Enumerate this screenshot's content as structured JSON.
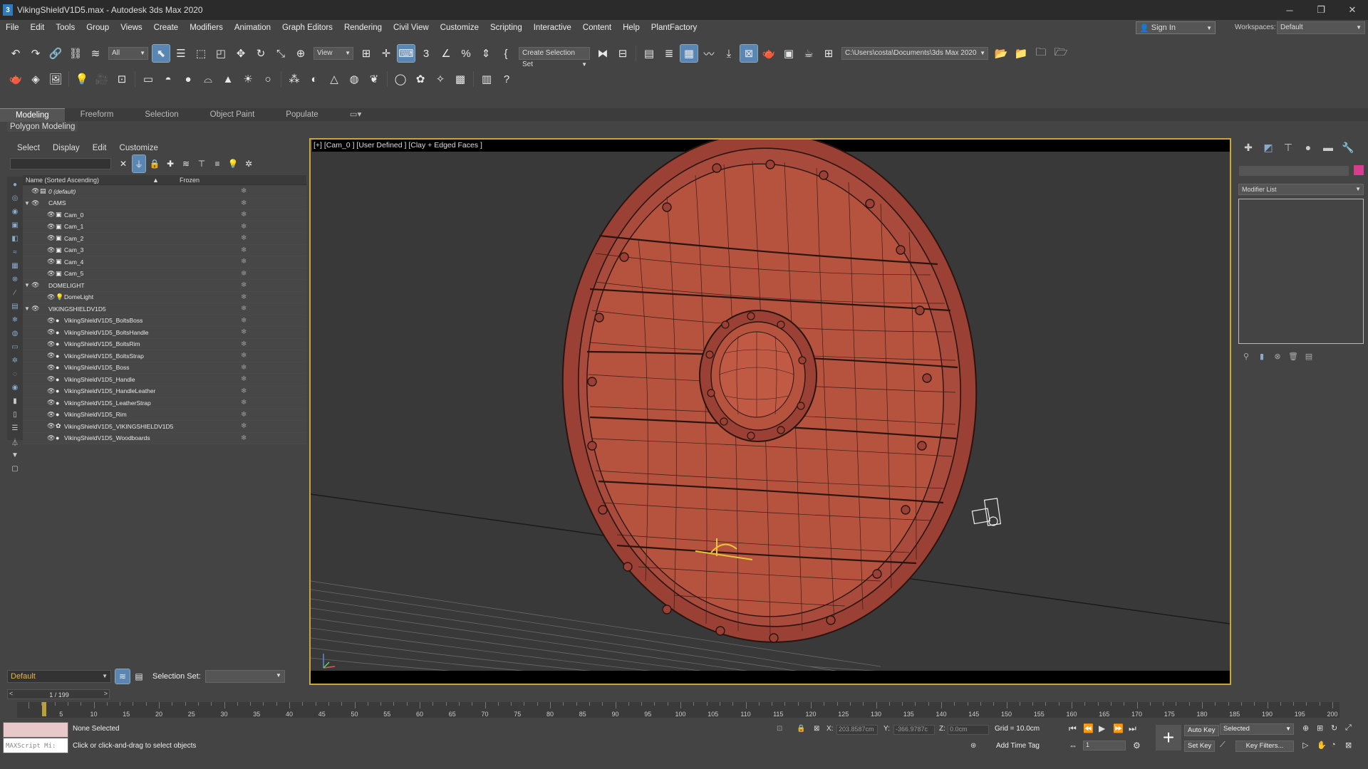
{
  "window": {
    "title": "VikingShieldV1D5.max - Autodesk 3ds Max 2020",
    "app_icon": "3",
    "controls": [
      "─",
      "❐",
      "✕"
    ]
  },
  "menu": [
    "File",
    "Edit",
    "Tools",
    "Group",
    "Views",
    "Create",
    "Modifiers",
    "Animation",
    "Graph Editors",
    "Rendering",
    "Civil View",
    "Customize",
    "Scripting",
    "Interactive",
    "Content",
    "Help",
    "PlantFactory"
  ],
  "signin": {
    "label": "Sign In"
  },
  "workspaces": {
    "label": "Workspaces:",
    "value": "Default"
  },
  "toolbar": {
    "filter": "All",
    "ref_coord": "View",
    "selection_set": "Create Selection Set",
    "project_path": "C:\\Users\\costa\\Documents\\3ds Max 2020"
  },
  "ribbon": {
    "tabs": [
      "Modeling",
      "Freeform",
      "Selection",
      "Object Paint",
      "Populate"
    ],
    "panel": "Polygon Modeling"
  },
  "explorer": {
    "menu": [
      "Select",
      "Display",
      "Edit",
      "Customize"
    ],
    "columns": {
      "name": "Name (Sorted Ascending)",
      "sort": "▲",
      "frozen": "Frozen"
    },
    "rows": [
      {
        "label": "0 (default)",
        "level": 0,
        "exp": "",
        "icon": "layer"
      },
      {
        "label": "CAMS",
        "level": 0,
        "exp": "▼",
        "icon": "none"
      },
      {
        "label": "Cam_0",
        "level": 1,
        "exp": "",
        "icon": "camera"
      },
      {
        "label": "Cam_1",
        "level": 1,
        "exp": "",
        "icon": "camera"
      },
      {
        "label": "Cam_2",
        "level": 1,
        "exp": "",
        "icon": "camera"
      },
      {
        "label": "Cam_3",
        "level": 1,
        "exp": "",
        "icon": "camera"
      },
      {
        "label": "Cam_4",
        "level": 1,
        "exp": "",
        "icon": "camera"
      },
      {
        "label": "Cam_5",
        "level": 1,
        "exp": "",
        "icon": "camera"
      },
      {
        "label": "DOMELIGHT",
        "level": 0,
        "exp": "▼",
        "icon": "none"
      },
      {
        "label": "DomeLight",
        "level": 1,
        "exp": "",
        "icon": "light"
      },
      {
        "label": "VIKINGSHIELDV1D5",
        "level": 0,
        "exp": "▼",
        "icon": "none"
      },
      {
        "label": "VikingShieldV1D5_BoltsBoss",
        "level": 1,
        "exp": "",
        "icon": "geo"
      },
      {
        "label": "VikingShieldV1D5_BoltsHandle",
        "level": 1,
        "exp": "",
        "icon": "geo"
      },
      {
        "label": "VikingShieldV1D5_BoltsRim",
        "level": 1,
        "exp": "",
        "icon": "geo"
      },
      {
        "label": "VikingShieldV1D5_BoltsStrap",
        "level": 1,
        "exp": "",
        "icon": "geo"
      },
      {
        "label": "VikingShieldV1D5_Boss",
        "level": 1,
        "exp": "",
        "icon": "geo"
      },
      {
        "label": "VikingShieldV1D5_Handle",
        "level": 1,
        "exp": "",
        "icon": "geo"
      },
      {
        "label": "VikingShieldV1D5_HandleLeather",
        "level": 1,
        "exp": "",
        "icon": "geo"
      },
      {
        "label": "VikingShieldV1D5_LeatherStrap",
        "level": 1,
        "exp": "",
        "icon": "geo"
      },
      {
        "label": "VikingShieldV1D5_Rim",
        "level": 1,
        "exp": "",
        "icon": "geo"
      },
      {
        "label": "VikingShieldV1D5_VIKINGSHIELDV1D5",
        "level": 1,
        "exp": "",
        "icon": "helper"
      },
      {
        "label": "VikingShieldV1D5_Woodboards",
        "level": 1,
        "exp": "",
        "icon": "geo"
      }
    ]
  },
  "layer": {
    "current": "Default",
    "selection_set_label": "Selection Set:"
  },
  "viewport": {
    "label": "[+] [Cam_0 ] [User Defined ] [Clay + Edged Faces ]",
    "shield_color": "#a84a3c",
    "wire_color": "#2a1410"
  },
  "command_panel": {
    "modifier_list": "Modifier List",
    "accent": "#d83c8c"
  },
  "timeline": {
    "frame": "1 / 199",
    "prev": "<",
    "next": ">",
    "ticks": [
      5,
      10,
      15,
      20,
      25,
      30,
      35,
      40,
      45,
      50,
      55,
      60,
      65,
      70,
      75,
      80,
      85,
      90,
      95,
      100,
      105,
      110,
      115,
      120,
      125,
      130,
      135,
      140,
      145,
      150,
      155,
      160,
      165,
      170,
      175,
      180,
      185,
      190,
      195,
      200
    ],
    "current_frame": 1,
    "max_frame": 200
  },
  "status": {
    "maxscript": "MAXScript Mi:",
    "selected": "None Selected",
    "prompt": "Click or click-and-drag to select objects",
    "x_label": "X:",
    "x_value": "203.8587cm",
    "y_label": "Y:",
    "y_value": "-366.9787c",
    "z_label": "Z:",
    "z_value": "0.0cm",
    "grid": "Grid = 10.0cm",
    "add_time_tag": "Add Time Tag",
    "auto_key": "Auto Key",
    "set_key": "Set Key",
    "key_mode": "Selected",
    "key_filters": "Key Filters...",
    "frame_field": "1"
  }
}
